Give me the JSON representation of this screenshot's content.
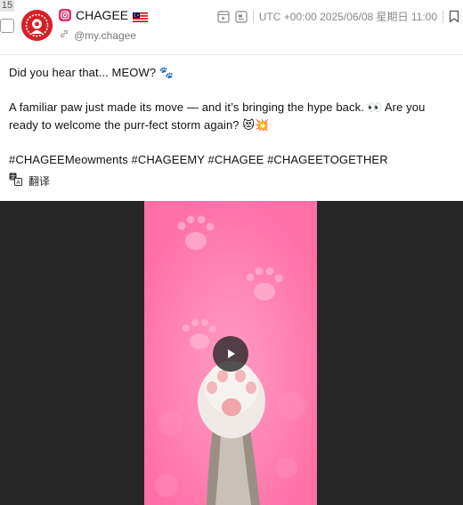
{
  "index": "15",
  "author": {
    "name": "CHAGEE",
    "handle": "@my.chagee",
    "platform_icon": "instagram-icon",
    "flag_icon": "malaysia-flag-icon"
  },
  "meta": {
    "timestamp": "UTC +00:00 2025/06/08 星期日 11:00"
  },
  "post": {
    "line1": "Did you hear that... MEOW? 🐾",
    "line2": "A familiar paw just made its move — and it’s bringing the hype back. 👀 Are you ready to welcome the purr-fect storm again? 😻💥",
    "hashtags": "#CHAGEEMeowments #CHAGEEMY #CHAGEE #CHAGEETOGETHER"
  },
  "translate_label": "翻译",
  "colors": {
    "brand_red": "#d81f26",
    "video_pink": "#ff7fb0",
    "video_bg": "#262626"
  }
}
